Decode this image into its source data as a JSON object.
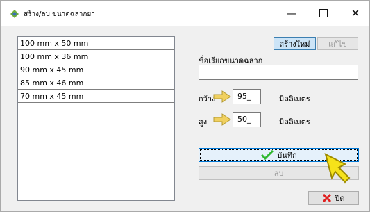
{
  "window": {
    "title": "สร้าง/ลบ ขนาดฉลากยา",
    "icon": "app-icon",
    "controls": {
      "minimize": "—",
      "close": "✕"
    }
  },
  "sizes": [
    "100 mm x 50 mm",
    "100 mm x 36 mm",
    "90 mm x 45 mm",
    "85 mm x 46 mm",
    "70 mm x 45 mm"
  ],
  "buttons": {
    "new": "สร้างใหม่",
    "edit": "แก้ไข",
    "save": "บันทึก",
    "delete": "ลบ",
    "close": "ปิด"
  },
  "form": {
    "name_label": "ชื่อเรียกขนาดฉลาก",
    "name_value": "",
    "width_label": "กว้าง",
    "width_value": "95_",
    "height_label": "สูง",
    "height_value": "50_",
    "unit": "มิลลิเมตร"
  },
  "colors": {
    "accent": "#0078d7",
    "arrow": "#f0d060",
    "check": "#2fb82f",
    "close_x": "#e02020"
  }
}
